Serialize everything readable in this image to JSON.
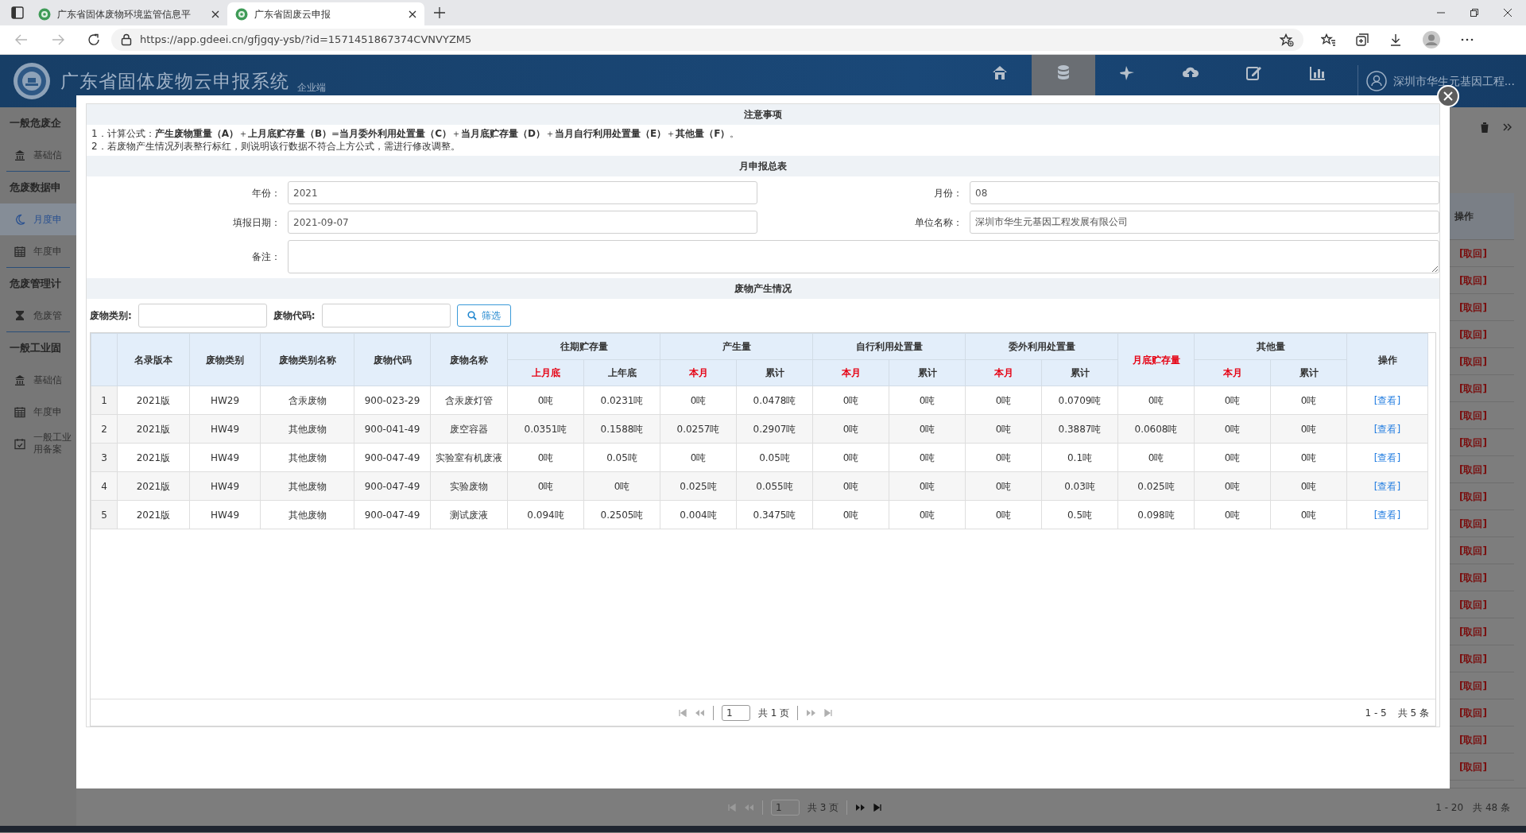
{
  "browser": {
    "tabs": [
      {
        "title": "广东省固体废物环境监管信息平",
        "selected": false
      },
      {
        "title": "广东省固废云申报",
        "selected": true
      }
    ],
    "url": "https://app.gdeei.cn/gfjgqy-ysb/?id=1571451867374CVNVYZM5"
  },
  "header": {
    "title": "广东省固体废物云申报系统",
    "subtitle": "企业端",
    "nav": [
      {
        "selected": false
      },
      {
        "selected": true
      },
      {
        "selected": false
      },
      {
        "selected": false
      },
      {
        "selected": false
      },
      {
        "selected": false
      }
    ],
    "company": "深圳市华生元基因工程..."
  },
  "sidebar": {
    "groups": [
      {
        "title": "一般危废企",
        "items": [
          {
            "label": "基础信",
            "selected": false
          }
        ]
      },
      {
        "title": "危废数据申",
        "items": [
          {
            "label": "月度申",
            "selected": true
          },
          {
            "label": "年度申",
            "selected": false
          }
        ]
      },
      {
        "title": "危废管理计",
        "items": [
          {
            "label": "危废管",
            "selected": false
          }
        ]
      },
      {
        "title": "一般工业固",
        "items": [
          {
            "label": "基础信",
            "selected": false
          },
          {
            "label": "年度申",
            "selected": false
          },
          {
            "label": "一般工业用备案",
            "selected": false
          }
        ]
      }
    ]
  },
  "background_page": {
    "column": "操作",
    "rows": [
      {
        "action": "[取回]"
      },
      {
        "action": "[取回]"
      },
      {
        "action": "[取回]"
      },
      {
        "action": "[取回]"
      },
      {
        "action": "[取回]"
      },
      {
        "action": "[取回]"
      },
      {
        "action": "[取回]"
      },
      {
        "action": "[取回]"
      },
      {
        "action": "[取回]"
      },
      {
        "action": "[取回]"
      },
      {
        "action": "[取回]"
      },
      {
        "action": "[取回]"
      },
      {
        "action": "[取回]"
      },
      {
        "action": "[取回]"
      },
      {
        "action": "[取回]"
      },
      {
        "action": "[取回]"
      },
      {
        "action": "[取回]"
      },
      {
        "action": "[取回]"
      },
      {
        "action": "[取回]"
      },
      {
        "action": "[取回]"
      }
    ],
    "pager": {
      "page": "1",
      "pages": "共 3 页",
      "range": "1 - 20",
      "total": "共 48 条"
    }
  },
  "modal": {
    "notice": {
      "title": "注意事项",
      "lines": [
        "1．计算公式：**产生废物重量（A）**＋**上月底贮存量（B）**=**当月委外利用处置量（C）**＋**当月底贮存量（D）**＋**当月自行利用处置量（E）**＋**其他量（F）**。",
        "2．若废物产生情况列表整行标红，则说明该行数据不符合上方公式，需进行修改调整。"
      ]
    },
    "summary": {
      "title": "月申报总表",
      "fields": [
        {
          "label": "年份：",
          "value": "2021",
          "kind": "input"
        },
        {
          "label": "月份：",
          "value": "08",
          "kind": "input"
        },
        {
          "label": "填报日期：",
          "value": "2021-09-07",
          "kind": "input"
        },
        {
          "label": "单位名称：",
          "value": "深圳市华生元基因工程发展有限公司",
          "kind": "input"
        },
        {
          "label": "备注：",
          "kind": "textarea"
        }
      ]
    },
    "waste": {
      "title": "废物产生情况",
      "filters": [
        {
          "label": "废物类别:"
        },
        {
          "label": "废物代码:"
        }
      ],
      "filter_button": "筛选",
      "columns": [
        {
          "label": "名录版本",
          "highlight": false
        },
        {
          "label": "废物类别",
          "highlight": false
        },
        {
          "label": "废物类别名称",
          "highlight": false
        },
        {
          "label": "废物代码",
          "highlight": false
        },
        {
          "label": "废物名称",
          "highlight": false
        },
        {
          "label": "往期贮存量",
          "highlight": false,
          "colspan": 2,
          "children": [
            {
              "label": "上月底",
              "highlight": true
            },
            {
              "label": "上年底",
              "highlight": false
            }
          ]
        },
        {
          "label": "产生量",
          "highlight": false,
          "colspan": 2,
          "children": [
            {
              "label": "本月",
              "highlight": true
            },
            {
              "label": "累计",
              "highlight": false
            }
          ]
        },
        {
          "label": "自行利用处置量",
          "highlight": false,
          "colspan": 2,
          "children": [
            {
              "label": "本月",
              "highlight": true
            },
            {
              "label": "累计",
              "highlight": false
            }
          ]
        },
        {
          "label": "委外利用处置量",
          "highlight": false,
          "colspan": 2,
          "children": [
            {
              "label": "本月",
              "highlight": true
            },
            {
              "label": "累计",
              "highlight": false
            }
          ]
        },
        {
          "label": "月底贮存量",
          "highlight": true
        },
        {
          "label": "其他量",
          "highlight": false,
          "colspan": 2,
          "children": [
            {
              "label": "本月",
              "highlight": true
            },
            {
              "label": "累计",
              "highlight": false
            }
          ]
        },
        {
          "label": "操作",
          "highlight": false
        }
      ],
      "rows": [
        {
          "index": "1",
          "cells": [
            "2021版",
            "HW29",
            "含汞废物",
            "900-023-29",
            "含汞废灯管",
            "0吨",
            "0.0231吨",
            "0吨",
            "0.0478吨",
            "0吨",
            "0吨",
            "0吨",
            "0.0709吨",
            "0吨",
            "0吨",
            "0吨"
          ],
          "action": "[查看]"
        },
        {
          "index": "2",
          "cells": [
            "2021版",
            "HW49",
            "其他废物",
            "900-041-49",
            "废空容器",
            "0.0351吨",
            "0.1588吨",
            "0.0257吨",
            "0.2907吨",
            "0吨",
            "0吨",
            "0吨",
            "0.3887吨",
            "0.0608吨",
            "0吨",
            "0吨"
          ],
          "action": "[查看]"
        },
        {
          "index": "3",
          "cells": [
            "2021版",
            "HW49",
            "其他废物",
            "900-047-49",
            "实验室有机废液",
            "0吨",
            "0.05吨",
            "0吨",
            "0.05吨",
            "0吨",
            "0吨",
            "0吨",
            "0.1吨",
            "0吨",
            "0吨",
            "0吨"
          ],
          "action": "[查看]"
        },
        {
          "index": "4",
          "cells": [
            "2021版",
            "HW49",
            "其他废物",
            "900-047-49",
            "实验废物",
            "0吨",
            "0吨",
            "0.025吨",
            "0.055吨",
            "0吨",
            "0吨",
            "0吨",
            "0.03吨",
            "0.025吨",
            "0吨",
            "0吨"
          ],
          "action": "[查看]"
        },
        {
          "index": "5",
          "cells": [
            "2021版",
            "HW49",
            "其他废物",
            "900-047-49",
            "测试废液",
            "0.094吨",
            "0.2505吨",
            "0.004吨",
            "0.3475吨",
            "0吨",
            "0吨",
            "0吨",
            "0.5吨",
            "0.098吨",
            "0吨",
            "0吨"
          ],
          "action": "[查看]"
        }
      ],
      "pager": {
        "page": "1",
        "pages": "共 1 页",
        "range": "1 - 5",
        "total": "共 5 条"
      }
    }
  }
}
